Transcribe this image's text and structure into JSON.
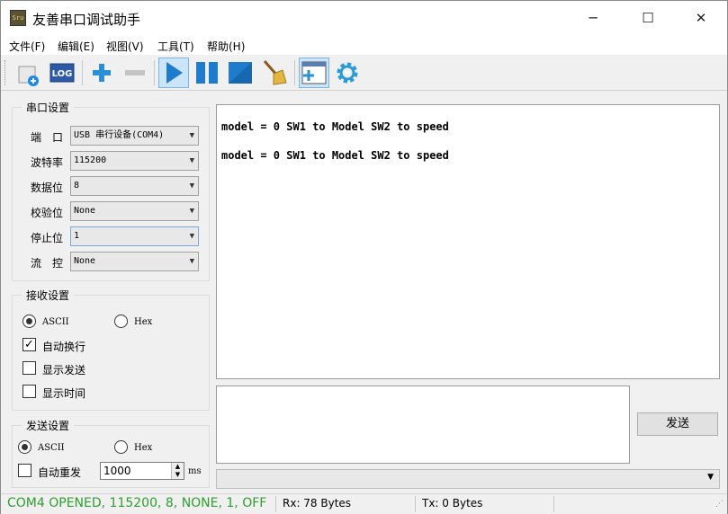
{
  "window": {
    "title": "友善串口调试助手",
    "icon_text": "Sru"
  },
  "menu": [
    "文件(F)",
    "编辑(E)",
    "视图(V)",
    "工具(T)",
    "帮助(H)"
  ],
  "toolbar": {
    "log_label": "LOG",
    "icons": [
      "new-session-icon",
      "log-icon",
      "add-icon",
      "remove-icon",
      "play-icon",
      "pause-icon",
      "stop-icon",
      "clear-broom-icon",
      "add-window-icon",
      "settings-gear-icon"
    ]
  },
  "serial_settings": {
    "legend": "串口设置",
    "fields": [
      {
        "label": "端　口",
        "value": "USB 串行设备(COM4)"
      },
      {
        "label": "波特率",
        "value": "115200"
      },
      {
        "label": "数据位",
        "value": "8"
      },
      {
        "label": "校验位",
        "value": "None"
      },
      {
        "label": "停止位",
        "value": "1"
      },
      {
        "label": "流　控",
        "value": "None"
      }
    ]
  },
  "receive_settings": {
    "legend": "接收设置",
    "ascii_label": "ASCII",
    "hex_label": "Hex",
    "selected": "ASCII",
    "auto_newline_label": "自动换行",
    "auto_newline": true,
    "show_send_label": "显示发送",
    "show_send": false,
    "show_time_label": "显示时间",
    "show_time": false
  },
  "send_settings": {
    "legend": "发送设置",
    "ascii_label": "ASCII",
    "hex_label": "Hex",
    "selected": "ASCII",
    "auto_resend_label": "自动重发",
    "auto_resend": false,
    "interval_value": "1000",
    "interval_unit": "ms"
  },
  "receive_area": {
    "lines": [
      "model = 0 SW1 to Model SW2 to speed",
      "model = 0 SW1 to Model SW2 to speed"
    ]
  },
  "send_area": {
    "text": "",
    "send_button": "发送"
  },
  "status": {
    "connection": "COM4 OPENED, 115200, 8, NONE, 1, OFF",
    "connection_color": "#2e9e2e",
    "rx": "Rx: 78 Bytes",
    "tx": "Tx: 0 Bytes"
  }
}
